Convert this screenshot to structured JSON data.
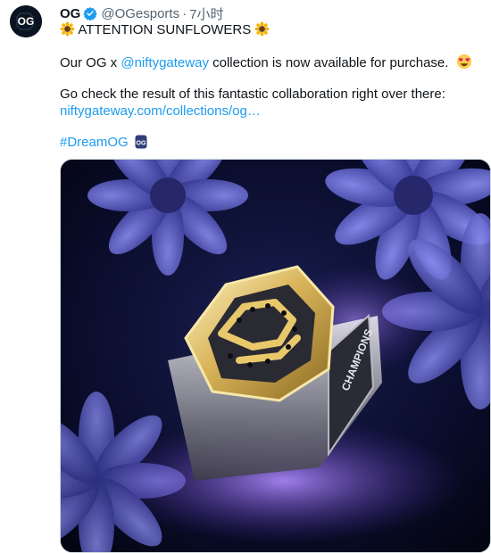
{
  "author": {
    "display_name": "OG",
    "handle": "@OGesports",
    "separator": "·",
    "time": "7小时",
    "avatar_text": "OG"
  },
  "tweet": {
    "line1_text": "ATTENTION SUNFLOWERS",
    "line2_prefix": "Our OG x ",
    "line2_mention": "@niftygateway",
    "line2_suffix": " collection is now available for purchase.",
    "line3_text": "Go check the result of this fantastic collaboration right over there:",
    "link_text": "niftygateway.com/collections/og…",
    "hashtag": "#DreamOG"
  },
  "media": {
    "ring_band_text": "CHAMPIONS"
  },
  "colors": {
    "link": "#1d9bf0",
    "verified": "#1d9bf0",
    "muted": "#536471"
  },
  "icons": {
    "verified": "verified-badge-icon",
    "flower": "sunflower-emoji",
    "heart_eyes": "heart-eyes-emoji",
    "og_badge": "og-hashtag-emoji"
  }
}
